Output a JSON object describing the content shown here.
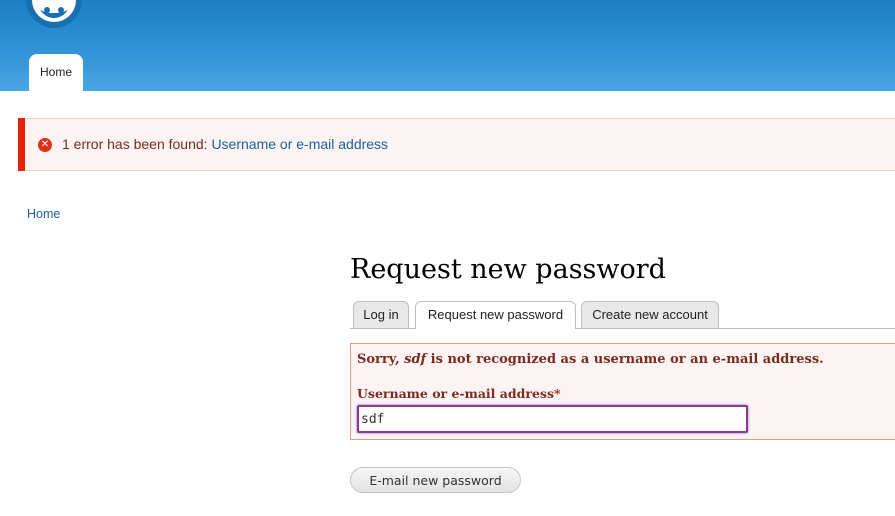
{
  "header": {
    "logo_icon": "drupal-drop-icon",
    "nav": {
      "home_label": "Home"
    },
    "background": "#2a8fd3"
  },
  "messages": {
    "icon": "error-x-icon",
    "prefix": "1 error has been found: ",
    "link_text": "Username or e-mail address",
    "bar_color": "#e2250a"
  },
  "breadcrumb": {
    "home_label": "Home"
  },
  "page": {
    "title": "Request new password",
    "tabs": [
      {
        "label": "Log in"
      },
      {
        "label": "Request new password",
        "active": true
      },
      {
        "label": "Create new account"
      }
    ]
  },
  "form": {
    "error_prefix": "Sorry, ",
    "error_value": "sdf",
    "error_suffix": " is not recognized as a username or an e-mail address.",
    "field_label": "Username or e-mail address",
    "required_marker": "*",
    "field_value": "sdf",
    "submit_label": "E-mail new password"
  }
}
